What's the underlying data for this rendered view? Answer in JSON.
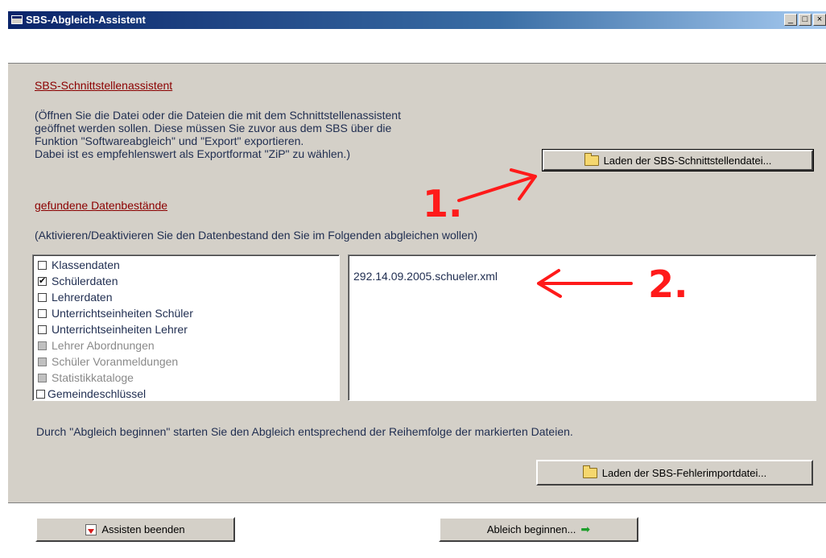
{
  "window": {
    "title": "SBS-Abgleich-Assistent",
    "controls": [
      "_",
      "□",
      "×"
    ]
  },
  "section1": {
    "heading": "SBS-Schnittstellenassistent",
    "description_lines": [
      "(Öffnen Sie die Datei oder die Dateien die mit dem Schnittstellenassistent",
      "geöffnet werden sollen. Diese müssen Sie zuvor aus dem SBS über die",
      "Funktion \"Softwareabgleich\" und \"Export\" exportieren.",
      "Dabei ist es empfehlenswert als Exportformat \"ZiP\" zu wählen.)"
    ],
    "load_button": "Laden der SBS-Schnittstellendatei..."
  },
  "section2": {
    "heading": "gefundene Datenbestände",
    "instruction": "(Aktivieren/Deaktivieren Sie den Datenbestand den Sie im Folgenden abgleichen wollen)",
    "items": [
      {
        "label": "Klassendaten",
        "checked": false,
        "enabled": true
      },
      {
        "label": "Schülerdaten",
        "checked": true,
        "enabled": true
      },
      {
        "label": "Lehrerdaten",
        "checked": false,
        "enabled": true
      },
      {
        "label": "Unterrichtseinheiten Schüler",
        "checked": false,
        "enabled": true
      },
      {
        "label": "Unterrichtseinheiten Lehrer",
        "checked": false,
        "enabled": true
      },
      {
        "label": "Lehrer Abordnungen",
        "checked": false,
        "enabled": false
      },
      {
        "label": "Schüler Voranmeldungen",
        "checked": false,
        "enabled": false
      },
      {
        "label": "Statistikkataloge",
        "checked": false,
        "enabled": false
      },
      {
        "label": "Gemeindeschlüssel",
        "checked": false,
        "enabled": true
      }
    ],
    "files": [
      "292.14.09.2005.schueler.xml"
    ]
  },
  "info_text": "Durch \"Abgleich beginnen\" starten Sie den Abgleich entsprechend der Reihemfolge der markierten Dateien.",
  "error_button": "Laden der SBS-Fehlerimportdatei...",
  "footer": {
    "exit_button": "Assisten beenden",
    "start_button": "Ableich beginnen..."
  },
  "annotations": {
    "one": "1.",
    "two": "2."
  }
}
